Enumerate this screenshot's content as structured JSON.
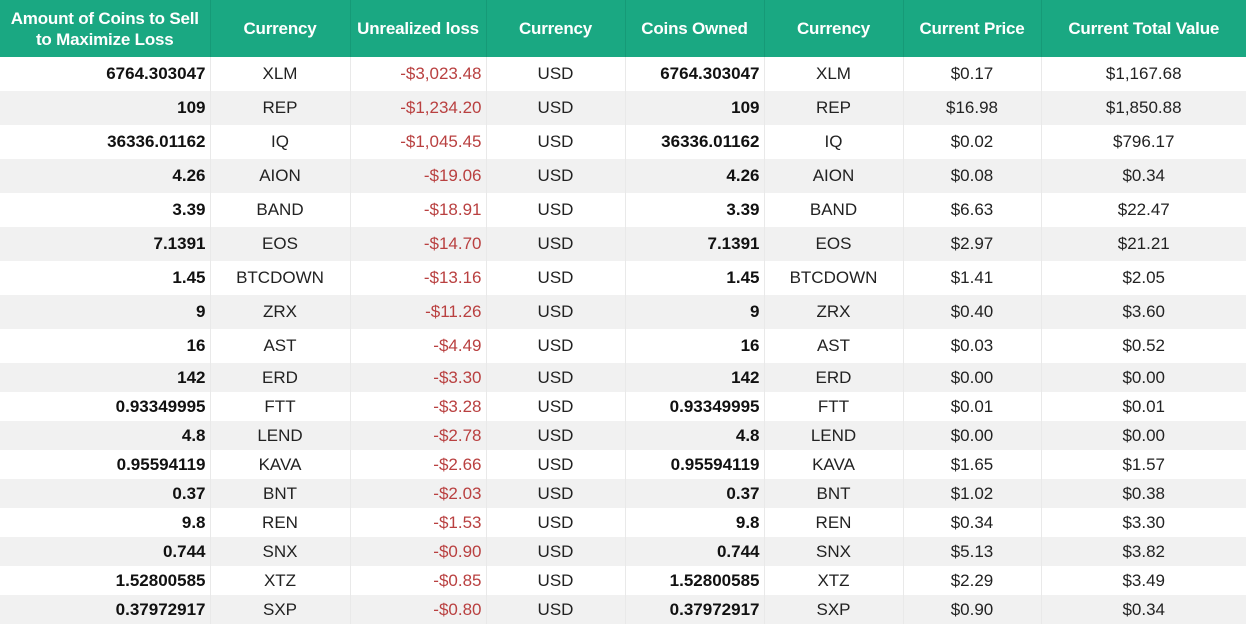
{
  "table": {
    "headers": [
      "Amount of Coins to Sell to Maximize Loss",
      "Currency",
      "Unrealized loss",
      "Currency",
      "Coins Owned",
      "Currency",
      "Current Price",
      "Current Total Value"
    ],
    "rows": [
      {
        "sell_amount": "6764.303047",
        "coin": "XLM",
        "unrealized_loss": "-$3,023.48",
        "loss_currency": "USD",
        "coins_owned": "6764.303047",
        "owned_coin": "XLM",
        "current_price": "$0.17",
        "total_value": "$1,167.68"
      },
      {
        "sell_amount": "109",
        "coin": "REP",
        "unrealized_loss": "-$1,234.20",
        "loss_currency": "USD",
        "coins_owned": "109",
        "owned_coin": "REP",
        "current_price": "$16.98",
        "total_value": "$1,850.88"
      },
      {
        "sell_amount": "36336.01162",
        "coin": "IQ",
        "unrealized_loss": "-$1,045.45",
        "loss_currency": "USD",
        "coins_owned": "36336.01162",
        "owned_coin": "IQ",
        "current_price": "$0.02",
        "total_value": "$796.17"
      },
      {
        "sell_amount": "4.26",
        "coin": "AION",
        "unrealized_loss": "-$19.06",
        "loss_currency": "USD",
        "coins_owned": "4.26",
        "owned_coin": "AION",
        "current_price": "$0.08",
        "total_value": "$0.34"
      },
      {
        "sell_amount": "3.39",
        "coin": "BAND",
        "unrealized_loss": "-$18.91",
        "loss_currency": "USD",
        "coins_owned": "3.39",
        "owned_coin": "BAND",
        "current_price": "$6.63",
        "total_value": "$22.47"
      },
      {
        "sell_amount": "7.1391",
        "coin": "EOS",
        "unrealized_loss": "-$14.70",
        "loss_currency": "USD",
        "coins_owned": "7.1391",
        "owned_coin": "EOS",
        "current_price": "$2.97",
        "total_value": "$21.21"
      },
      {
        "sell_amount": "1.45",
        "coin": "BTCDOWN",
        "unrealized_loss": "-$13.16",
        "loss_currency": "USD",
        "coins_owned": "1.45",
        "owned_coin": "BTCDOWN",
        "current_price": "$1.41",
        "total_value": "$2.05"
      },
      {
        "sell_amount": "9",
        "coin": "ZRX",
        "unrealized_loss": "-$11.26",
        "loss_currency": "USD",
        "coins_owned": "9",
        "owned_coin": "ZRX",
        "current_price": "$0.40",
        "total_value": "$3.60"
      },
      {
        "sell_amount": "16",
        "coin": "AST",
        "unrealized_loss": "-$4.49",
        "loss_currency": "USD",
        "coins_owned": "16",
        "owned_coin": "AST",
        "current_price": "$0.03",
        "total_value": "$0.52"
      },
      {
        "sell_amount": "142",
        "coin": "ERD",
        "unrealized_loss": "-$3.30",
        "loss_currency": "USD",
        "coins_owned": "142",
        "owned_coin": "ERD",
        "current_price": "$0.00",
        "total_value": "$0.00"
      },
      {
        "sell_amount": "0.93349995",
        "coin": "FTT",
        "unrealized_loss": "-$3.28",
        "loss_currency": "USD",
        "coins_owned": "0.93349995",
        "owned_coin": "FTT",
        "current_price": "$0.01",
        "total_value": "$0.01"
      },
      {
        "sell_amount": "4.8",
        "coin": "LEND",
        "unrealized_loss": "-$2.78",
        "loss_currency": "USD",
        "coins_owned": "4.8",
        "owned_coin": "LEND",
        "current_price": "$0.00",
        "total_value": "$0.00"
      },
      {
        "sell_amount": "0.95594119",
        "coin": "KAVA",
        "unrealized_loss": "-$2.66",
        "loss_currency": "USD",
        "coins_owned": "0.95594119",
        "owned_coin": "KAVA",
        "current_price": "$1.65",
        "total_value": "$1.57"
      },
      {
        "sell_amount": "0.37",
        "coin": "BNT",
        "unrealized_loss": "-$2.03",
        "loss_currency": "USD",
        "coins_owned": "0.37",
        "owned_coin": "BNT",
        "current_price": "$1.02",
        "total_value": "$0.38"
      },
      {
        "sell_amount": "9.8",
        "coin": "REN",
        "unrealized_loss": "-$1.53",
        "loss_currency": "USD",
        "coins_owned": "9.8",
        "owned_coin": "REN",
        "current_price": "$0.34",
        "total_value": "$3.30"
      },
      {
        "sell_amount": "0.744",
        "coin": "SNX",
        "unrealized_loss": "-$0.90",
        "loss_currency": "USD",
        "coins_owned": "0.744",
        "owned_coin": "SNX",
        "current_price": "$5.13",
        "total_value": "$3.82"
      },
      {
        "sell_amount": "1.52800585",
        "coin": "XTZ",
        "unrealized_loss": "-$0.85",
        "loss_currency": "USD",
        "coins_owned": "1.52800585",
        "owned_coin": "XTZ",
        "current_price": "$2.29",
        "total_value": "$3.49"
      },
      {
        "sell_amount": "0.37972917",
        "coin": "SXP",
        "unrealized_loss": "-$0.80",
        "loss_currency": "USD",
        "coins_owned": "0.37972917",
        "owned_coin": "SXP",
        "current_price": "$0.90",
        "total_value": "$0.34"
      }
    ]
  },
  "colors": {
    "header_bg": "#1aa882",
    "header_text": "#ffffff",
    "loss_text": "#b94040",
    "row_alt_bg": "#f1f1f1"
  }
}
